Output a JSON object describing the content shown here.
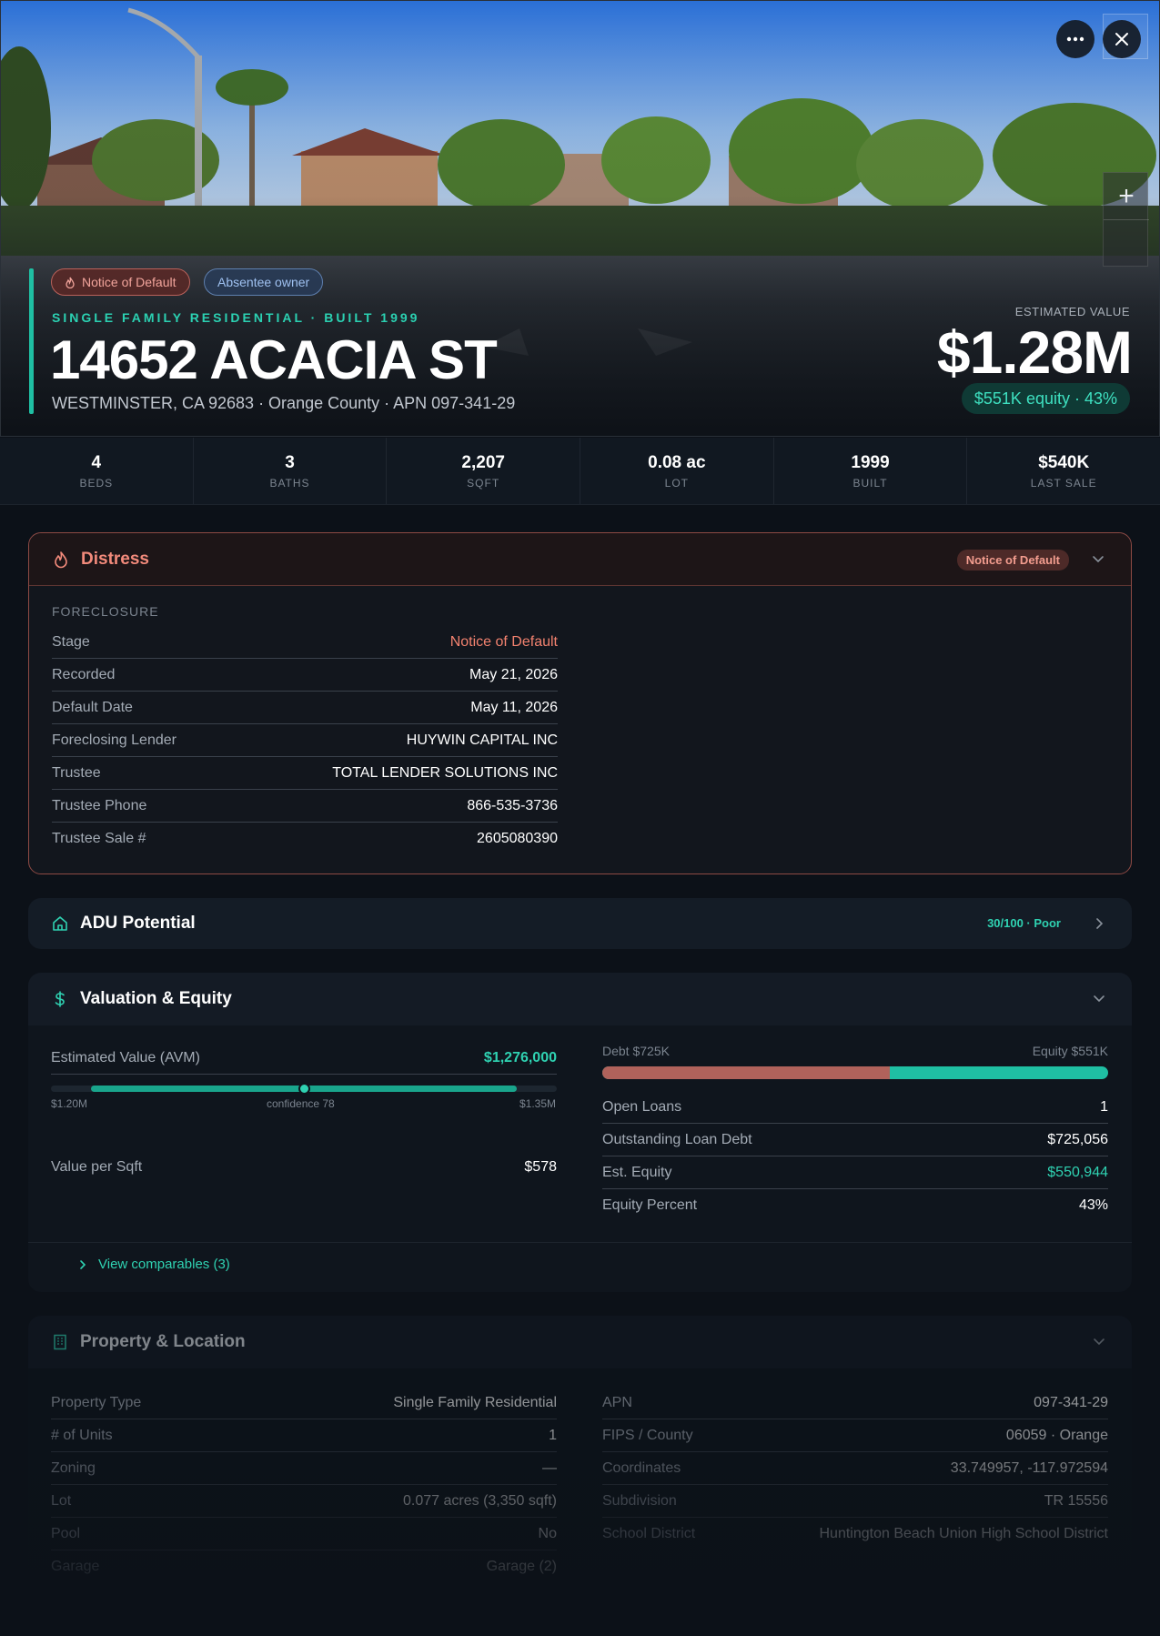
{
  "hero": {
    "chips": [
      "Notice of Default",
      "Absentee owner"
    ],
    "kicker": "SINGLE FAMILY RESIDENTIAL · BUILT 1999",
    "address": "14652 ACACIA ST",
    "subline": "WESTMINSTER, CA 92683 · Orange County · APN 097-341-29",
    "est_label": "ESTIMATED VALUE",
    "est_value": "$1.28M",
    "equity_chip": "$551K equity · 43%",
    "more_icon": "more-horizontal-icon",
    "close_icon": "close-icon",
    "zoom_in": "+"
  },
  "stats": [
    {
      "value": "4",
      "label": "BEDS"
    },
    {
      "value": "3",
      "label": "BATHS"
    },
    {
      "value": "2,207",
      "label": "SQFT"
    },
    {
      "value": "0.08 ac",
      "label": "LOT"
    },
    {
      "value": "1999",
      "label": "BUILT"
    },
    {
      "value": "$540K",
      "label": "LAST SALE"
    }
  ],
  "distress": {
    "title": "Distress",
    "badge": "Notice of Default",
    "section": "FORECLOSURE",
    "rows": [
      {
        "k": "Stage",
        "v": "Notice of Default"
      },
      {
        "k": "Recorded",
        "v": "May 21, 2026"
      },
      {
        "k": "Default Date",
        "v": "May 11, 2026"
      },
      {
        "k": "Foreclosing Lender",
        "v": "HUYWIN CAPITAL INC"
      },
      {
        "k": "Trustee",
        "v": "TOTAL LENDER SOLUTIONS INC"
      },
      {
        "k": "Trustee Phone",
        "v": "866-535-3736"
      },
      {
        "k": "Trustee Sale #",
        "v": "2605080390"
      }
    ]
  },
  "adu": {
    "title": "ADU Potential",
    "score": "30/100 · Poor"
  },
  "valuation": {
    "title": "Valuation & Equity",
    "avm_label": "Estimated Value (AVM)",
    "avm_value": "$1,276,000",
    "range_low": "$1.20M",
    "range_high": "$1.35M",
    "confidence": "confidence 78",
    "range_fill_start": 0.08,
    "range_fill_end": 0.92,
    "range_marker": 0.5,
    "vps_label": "Value per Sqft",
    "vps_value": "$578",
    "debt_label": "Debt $725K",
    "equity_label": "Equity $551K",
    "debt_fraction": 0.568,
    "loans": [
      {
        "k": "Open Loans",
        "v": "1"
      },
      {
        "k": "Outstanding Loan Debt",
        "v": "$725,056"
      },
      {
        "k": "Est. Equity",
        "v": "$550,944"
      },
      {
        "k": "Equity Percent",
        "v": "43%"
      }
    ],
    "comps_link": "View comparables (3)"
  },
  "property": {
    "title": "Property & Location",
    "left": [
      {
        "k": "Property Type",
        "v": "Single Family Residential"
      },
      {
        "k": "# of Units",
        "v": "1"
      },
      {
        "k": "Zoning",
        "v": "—"
      },
      {
        "k": "Lot",
        "v": "0.077 acres (3,350 sqft)"
      },
      {
        "k": "Pool",
        "v": "No"
      },
      {
        "k": "Garage",
        "v": "Garage (2)"
      }
    ],
    "right": [
      {
        "k": "APN",
        "v": "097-341-29"
      },
      {
        "k": "FIPS / County",
        "v": "06059 · Orange"
      },
      {
        "k": "Coordinates",
        "v": "33.749957, -117.972594"
      },
      {
        "k": "Subdivision",
        "v": "TR 15556"
      },
      {
        "k": "School District",
        "v": "Huntington Beach Union High School District"
      }
    ]
  },
  "colors": {
    "accent": "#1fbfa3",
    "distress": "#f2826f",
    "debt": "#b0625b"
  }
}
